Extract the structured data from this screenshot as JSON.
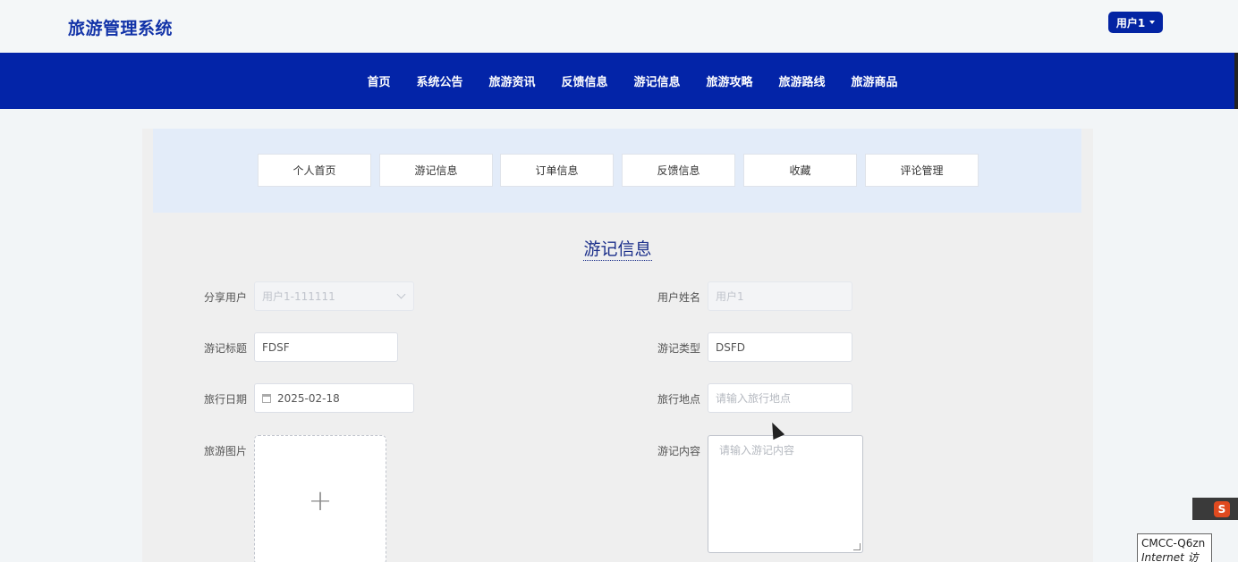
{
  "header": {
    "brand": "旅游管理系统",
    "user_button": "用户1"
  },
  "nav": {
    "items": [
      "首页",
      "系统公告",
      "旅游资讯",
      "反馈信息",
      "游记信息",
      "旅游攻略",
      "旅游路线",
      "旅游商品"
    ]
  },
  "tabs": [
    "个人首页",
    "游记信息",
    "订单信息",
    "反馈信息",
    "收藏",
    "评论管理"
  ],
  "form": {
    "title": "游记信息",
    "share_user_label": "分享用户",
    "share_user_value": "用户1-111111",
    "user_name_label": "用户姓名",
    "user_name_value": "用户1",
    "title_label": "游记标题",
    "title_value": "FDSF",
    "type_label": "游记类型",
    "type_value": "DSFD",
    "date_label": "旅行日期",
    "date_value": "2025-02-18",
    "place_label": "旅行地点",
    "place_placeholder": "请输入旅行地点",
    "image_label": "旅游图片",
    "upload_symbol": "+",
    "content_label": "游记内容",
    "content_placeholder": "请输入游记内容"
  },
  "system": {
    "tray_icon": "S",
    "network_name": "CMCC-Q6zn",
    "network_status": "Internet 访问"
  }
}
